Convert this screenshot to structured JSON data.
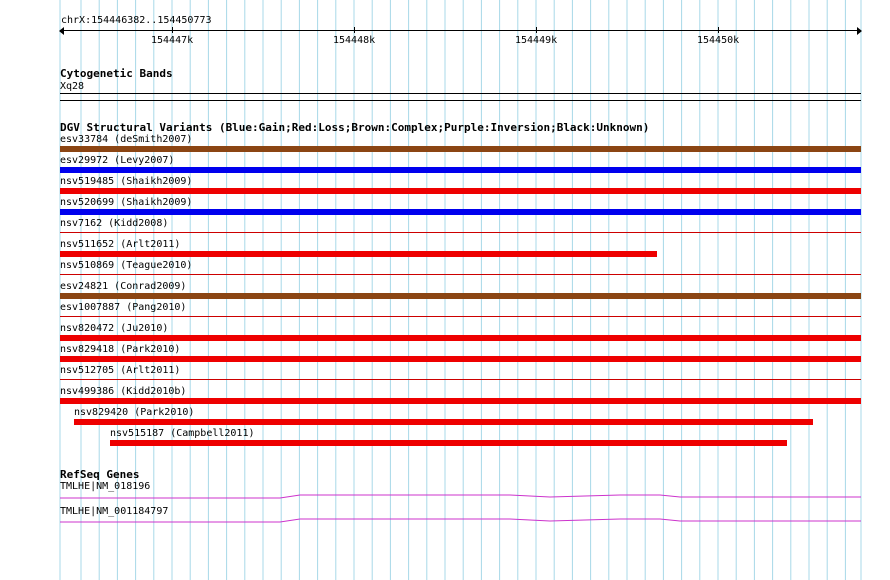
{
  "ruler": {
    "range": "chrX:154446382..154450773",
    "ticks": [
      {
        "label": "154447k"
      },
      {
        "label": "154448k"
      },
      {
        "label": "154449k"
      },
      {
        "label": "154450k"
      }
    ]
  },
  "cyto": {
    "title": "Cytogenetic Bands",
    "band": "Xq28"
  },
  "dgv": {
    "title": "DGV Structural Variants (Blue:Gain;Red:Loss;Brown:Complex;Purple:Inversion;Black:Unknown)",
    "colors": {
      "gain": "#0000ee",
      "loss": "#ee0000",
      "complex": "#8b4513",
      "thin_loss": "#cc0000"
    },
    "variants": [
      {
        "label": "esv33784 (deSmith2007)",
        "type": "complex"
      },
      {
        "label": "esv29972 (Levy2007)",
        "type": "gain"
      },
      {
        "label": "nsv519485 (Shaikh2009)",
        "type": "loss"
      },
      {
        "label": "nsv520699 (Shaikh2009)",
        "type": "gain"
      },
      {
        "label": "nsv7162 (Kidd2008)",
        "type": "loss"
      },
      {
        "label": "nsv511652 (Arlt2011)",
        "type": "loss"
      },
      {
        "label": "nsv510869 (Teague2010)",
        "type": "loss"
      },
      {
        "label": "esv24821 (Conrad2009)",
        "type": "complex"
      },
      {
        "label": "esv1007887 (Pang2010)",
        "type": "loss"
      },
      {
        "label": "nsv820472 (Ju2010)",
        "type": "loss"
      },
      {
        "label": "nsv829418 (Park2010)",
        "type": "loss"
      },
      {
        "label": "nsv512705 (Arlt2011)",
        "type": "loss"
      },
      {
        "label": "nsv499386 (Kidd2010b)",
        "type": "loss"
      },
      {
        "label": "nsv829420 (Park2010)",
        "type": "loss"
      },
      {
        "label": "nsv515187 (Campbell2011)",
        "type": "loss"
      }
    ]
  },
  "refseq": {
    "title": "RefSeq Genes",
    "color": "#cc33cc",
    "genes": [
      {
        "label": "TMLHE|NM_018196"
      },
      {
        "label": "TMLHE|NM_001184797"
      }
    ]
  },
  "grid_color": "#a8d8e8"
}
